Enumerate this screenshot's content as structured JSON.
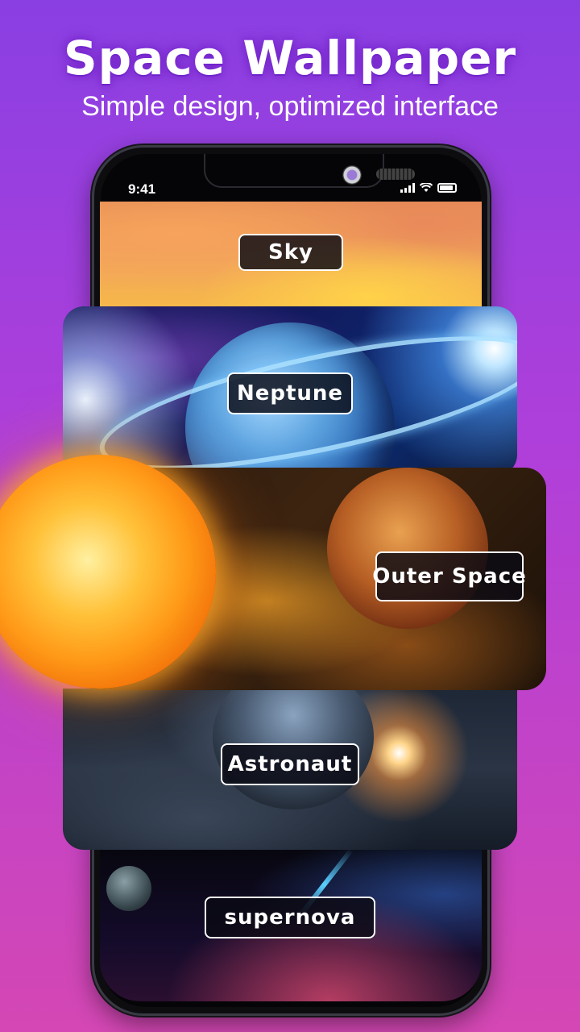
{
  "header": {
    "title": "Space Wallpaper",
    "subtitle": "Simple design, optimized interface"
  },
  "phone": {
    "status_time": "9:41"
  },
  "categories": [
    {
      "label": "Sky"
    },
    {
      "label": "Neptune"
    },
    {
      "label": "Outer Space"
    },
    {
      "label": "Astronaut"
    },
    {
      "label": "supernova"
    }
  ],
  "colors": {
    "background_top": "#8a3fe3",
    "background_bottom": "#d447b4",
    "label_border": "#ffffff"
  }
}
